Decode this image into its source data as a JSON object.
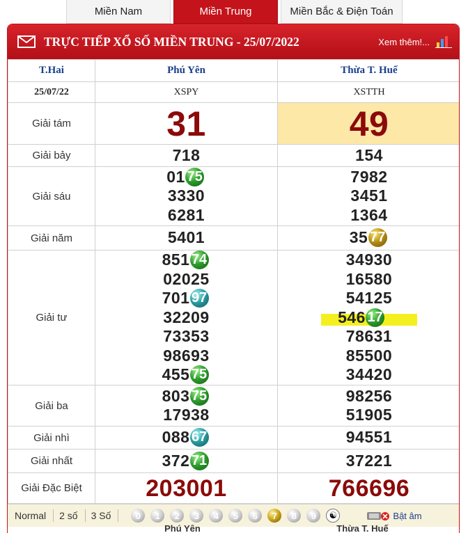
{
  "tabs": [
    {
      "label": "Miền Nam",
      "active": false
    },
    {
      "label": "Miền Trung",
      "active": true
    },
    {
      "label": "Miền Bắc & Điện Toán",
      "active": false
    }
  ],
  "banner": {
    "title": "TRỰC TIẾP XỔ SỐ MIỀN TRUNG - 25/07/2022",
    "more": "Xem thêm!...",
    "icons": [
      "mail-icon",
      "bar-chart-icon"
    ]
  },
  "header": {
    "weekday": "T.Hai",
    "date": "25/07/22",
    "provinces": [
      {
        "name": "Phú Yên",
        "code": "XSPY"
      },
      {
        "name": "Thừa T. Huế",
        "code": "XSTTH"
      }
    ]
  },
  "prizes": {
    "g8": {
      "label": "Giải tám",
      "values": [
        "31",
        "49"
      ]
    },
    "g7": {
      "label": "Giải bảy",
      "values": [
        "718",
        "154"
      ]
    },
    "g6": {
      "label": "Giải sáu",
      "col1": [
        "01",
        "3330",
        "6281"
      ],
      "col1_ball": "75",
      "col2": [
        "7982",
        "3451",
        "1364"
      ]
    },
    "g5": {
      "label": "Giải năm",
      "col1": "5401",
      "col2": "35",
      "col2_ball": "77"
    },
    "g4": {
      "label": "Giải tư",
      "col1": [
        "851",
        "02025",
        "701",
        "32209",
        "73353",
        "98693",
        "455"
      ],
      "col1_balls": [
        "74",
        "97",
        "75"
      ],
      "col2": [
        "34930",
        "16580",
        "54125",
        "546",
        "78631",
        "85500",
        "34420"
      ],
      "col2_ball": "17"
    },
    "g3": {
      "label": "Giải ba",
      "col1": [
        "803",
        "17938"
      ],
      "col1_ball": "75",
      "col2": [
        "98256",
        "51905"
      ]
    },
    "g2": {
      "label": "Giải nhì",
      "col1": "088",
      "col1_ball": "67",
      "col2": "94551"
    },
    "g1": {
      "label": "Giải nhất",
      "col1": "372",
      "col1_ball": "71",
      "col2": "37221"
    },
    "db": {
      "label": "Giải Đặc Biệt",
      "values": [
        "203001",
        "766696"
      ]
    }
  },
  "toolbar": {
    "options": [
      "Normal",
      "2 số",
      "3 Số"
    ],
    "digits": [
      "0",
      "1",
      "2",
      "3",
      "4",
      "5",
      "6",
      "7",
      "8",
      "9"
    ],
    "selected_digit": "7",
    "yinyang": "☯",
    "sound_label": "Bật âm"
  },
  "bottom": [
    "Phú Yên",
    "Thừa T. Huế"
  ],
  "colors": {
    "brand_red": "#c4131b",
    "prize_red": "#8b0a0a",
    "highlight_cell": "#fde8a7",
    "highlight_mark": "#f4f020",
    "link_blue": "#1a3e8a"
  }
}
